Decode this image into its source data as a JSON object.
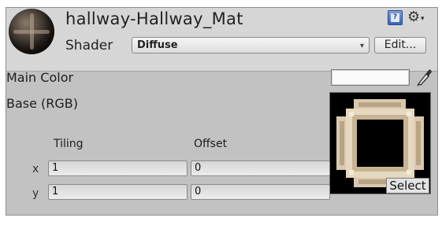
{
  "material": {
    "name": "hallway-Hallway_Mat",
    "shader_label": "Shader",
    "shader_value": "Diffuse",
    "edit_label": "Edit...",
    "dropdown_arrow": "▾"
  },
  "icons": {
    "help": "help-book-icon",
    "settings": "gear-icon",
    "eyedropper": "eyedropper-icon"
  },
  "properties": {
    "main_color_label": "Main Color",
    "main_color_value": "#fbfbfb",
    "base_label": "Base (RGB)",
    "tiling_label": "Tiling",
    "offset_label": "Offset",
    "x_label": "x",
    "y_label": "y",
    "tiling_x": "1",
    "tiling_y": "1",
    "offset_x": "0",
    "offset_y": "0",
    "select_label": "Select"
  },
  "colors": {
    "panel_bg": "#c2c2c2",
    "header_bg": "#d6d6d6",
    "texture_bg": "#000000",
    "texture_pattern": "#e4d6c0"
  }
}
